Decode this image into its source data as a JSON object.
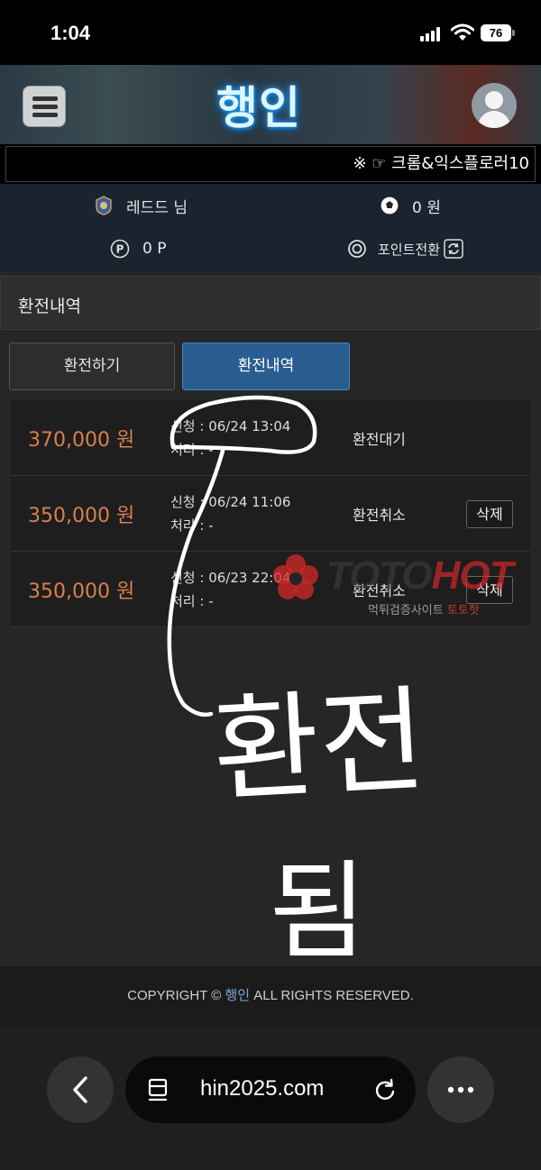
{
  "status": {
    "time": "1:04",
    "battery": "76"
  },
  "site": {
    "logo": "행인",
    "marquee": "※ ☞ 크롬&익스플로러10"
  },
  "user": {
    "nickname": "레드드 님",
    "money": "0 원",
    "points": "0 P",
    "point_convert_label": "포인트전환"
  },
  "section": {
    "title": "환전내역"
  },
  "tabs": {
    "apply": "환전하기",
    "history": "환전내역"
  },
  "records": [
    {
      "amount": "370,000 원",
      "requested": "신청 : 06/24 13:04",
      "processed": "처리 : -",
      "status": "환전대기",
      "delete": ""
    },
    {
      "amount": "350,000 원",
      "requested": "신청 : 06/24 11:06",
      "processed": "처리 : -",
      "status": "환전취소",
      "delete": "삭제"
    },
    {
      "amount": "350,000 원",
      "requested": "신청 : 06/23 22:04",
      "processed": "처리 : -",
      "status": "환전취소",
      "delete": "삭제"
    }
  ],
  "watermark": {
    "toto": "TOTO",
    "hot": "HOT",
    "sub_a": "먹튀검증사이트 ",
    "sub_b": "토토핫"
  },
  "handwriting": {
    "line1": "환전",
    "line2": "됨"
  },
  "footer": {
    "prefix": "COPYRIGHT © ",
    "brand": "행인",
    "suffix": " ALL RIGHTS RESERVED."
  },
  "browser": {
    "url": "hin2025.com"
  },
  "colors": {
    "amount": "#d9804e",
    "active_tab": "#2a5d8f",
    "logo_glow": "#1ea0ff"
  }
}
